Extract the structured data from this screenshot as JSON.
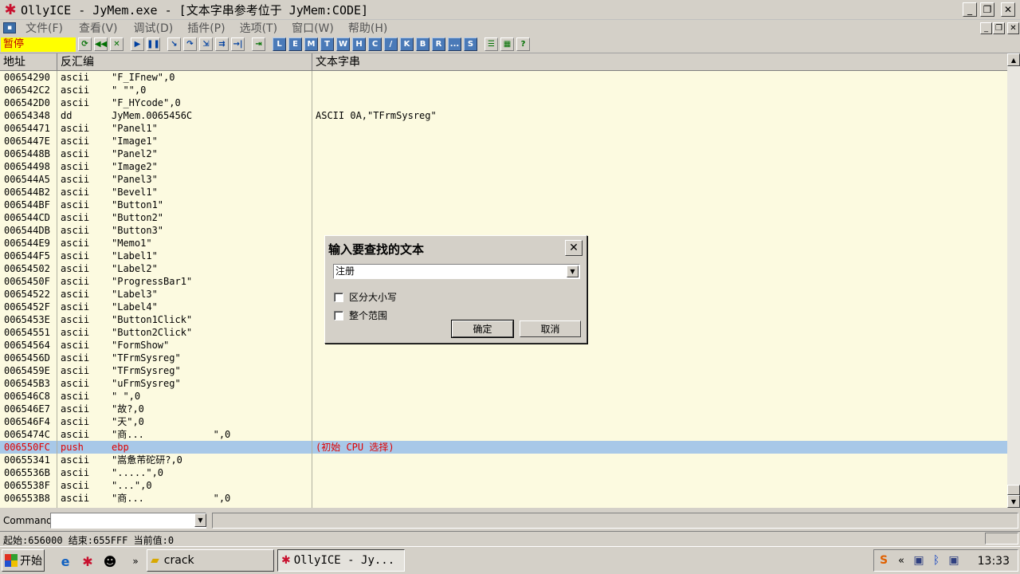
{
  "window": {
    "title": "OllyICE - JyMem.exe - [文本字串参考位于 JyMem:CODE]",
    "controls": {
      "minimize": "_",
      "restore": "❐",
      "close": "✕"
    }
  },
  "menu": [
    {
      "label": "文件(F)"
    },
    {
      "label": "查看(V)"
    },
    {
      "label": "调试(D)"
    },
    {
      "label": "插件(P)"
    },
    {
      "label": "选项(T)"
    },
    {
      "label": "窗口(W)"
    },
    {
      "label": "帮助(H)"
    }
  ],
  "toolbar": {
    "status": "暂停",
    "letters": [
      "L",
      "E",
      "M",
      "T",
      "W",
      "H",
      "C",
      "/",
      "K",
      "B",
      "R",
      "...",
      "S"
    ]
  },
  "columns": {
    "address": "地址",
    "disasm": "反汇编",
    "text": "文本字串"
  },
  "rows": [
    {
      "addr": "00654290",
      "op": "ascii",
      "arg": "\"F_IFnew\",0",
      "text": ""
    },
    {
      "addr": "006542C2",
      "op": "ascii",
      "arg": "\" \"\",0",
      "text": ""
    },
    {
      "addr": "006542D0",
      "op": "ascii",
      "arg": "\"F_HYcode\",0",
      "text": ""
    },
    {
      "addr": "00654348",
      "op": "dd",
      "arg": "JyMem.0065456C",
      "text": "ASCII 0A,\"TFrmSysreg\""
    },
    {
      "addr": "00654471",
      "op": "ascii",
      "arg": "\"Panel1\"",
      "text": ""
    },
    {
      "addr": "0065447E",
      "op": "ascii",
      "arg": "\"Image1\"",
      "text": ""
    },
    {
      "addr": "0065448B",
      "op": "ascii",
      "arg": "\"Panel2\"",
      "text": ""
    },
    {
      "addr": "00654498",
      "op": "ascii",
      "arg": "\"Image2\"",
      "text": ""
    },
    {
      "addr": "006544A5",
      "op": "ascii",
      "arg": "\"Panel3\"",
      "text": ""
    },
    {
      "addr": "006544B2",
      "op": "ascii",
      "arg": "\"Bevel1\"",
      "text": ""
    },
    {
      "addr": "006544BF",
      "op": "ascii",
      "arg": "\"Button1\"",
      "text": ""
    },
    {
      "addr": "006544CD",
      "op": "ascii",
      "arg": "\"Button2\"",
      "text": ""
    },
    {
      "addr": "006544DB",
      "op": "ascii",
      "arg": "\"Button3\"",
      "text": ""
    },
    {
      "addr": "006544E9",
      "op": "ascii",
      "arg": "\"Memo1\"",
      "text": ""
    },
    {
      "addr": "006544F5",
      "op": "ascii",
      "arg": "\"Label1\"",
      "text": ""
    },
    {
      "addr": "00654502",
      "op": "ascii",
      "arg": "\"Label2\"",
      "text": ""
    },
    {
      "addr": "0065450F",
      "op": "ascii",
      "arg": "\"ProgressBar1\"",
      "text": ""
    },
    {
      "addr": "00654522",
      "op": "ascii",
      "arg": "\"Label3\"",
      "text": ""
    },
    {
      "addr": "0065452F",
      "op": "ascii",
      "arg": "\"Label4\"",
      "text": ""
    },
    {
      "addr": "0065453E",
      "op": "ascii",
      "arg": "\"Button1Click\"",
      "text": ""
    },
    {
      "addr": "00654551",
      "op": "ascii",
      "arg": "\"Button2Click\"",
      "text": ""
    },
    {
      "addr": "00654564",
      "op": "ascii",
      "arg": "\"FormShow\"",
      "text": ""
    },
    {
      "addr": "0065456D",
      "op": "ascii",
      "arg": "\"TFrmSysreg\"",
      "text": ""
    },
    {
      "addr": "0065459E",
      "op": "ascii",
      "arg": "\"TFrmSysreg\"",
      "text": ""
    },
    {
      "addr": "006545B3",
      "op": "ascii",
      "arg": "\"uFrmSysreg\"",
      "text": ""
    },
    {
      "addr": "006546C8",
      "op": "ascii",
      "arg": "\" \",0",
      "text": ""
    },
    {
      "addr": "006546E7",
      "op": "ascii",
      "arg": "\"故?,0",
      "text": ""
    },
    {
      "addr": "006546F4",
      "op": "ascii",
      "arg": "\"天\",0",
      "text": ""
    },
    {
      "addr": "0065474C",
      "op": "ascii",
      "arg": "\"商...            \",0",
      "text": ""
    },
    {
      "addr": "006550FC",
      "op": "push",
      "arg": "ebp",
      "text": "(初始 CPU 选择)",
      "selected": true
    },
    {
      "addr": "00655341",
      "op": "ascii",
      "arg": "\"嵩惫芾砣研?,0",
      "text": ""
    },
    {
      "addr": "0065536B",
      "op": "ascii",
      "arg": "\".....\",0",
      "text": ""
    },
    {
      "addr": "0065538F",
      "op": "ascii",
      "arg": "\"...\",0",
      "text": ""
    },
    {
      "addr": "006553B8",
      "op": "ascii",
      "arg": "\"商...            \",0",
      "text": ""
    }
  ],
  "command": {
    "label": "Command",
    "value": ""
  },
  "statusbar": {
    "text": "起始:656000 结束:655FFF 当前值:0"
  },
  "dialog": {
    "title": "输入要查找的文本",
    "input_value": "注册",
    "case_label": "区分大小写",
    "range_label": "整个范围",
    "ok": "确定",
    "cancel": "取消"
  },
  "taskbar": {
    "start": "开始",
    "tasks": [
      {
        "label": "crack"
      },
      {
        "label": "OllyICE - Jy..."
      }
    ],
    "tray_arrow": "«",
    "clock": "13:33"
  },
  "colors": {
    "pause_bg": "#ffff00",
    "pause_fg": "#c00000",
    "list_bg": "#fcfae0",
    "selection_bg": "#a8c8e8",
    "selection_fg": "#e00000"
  }
}
